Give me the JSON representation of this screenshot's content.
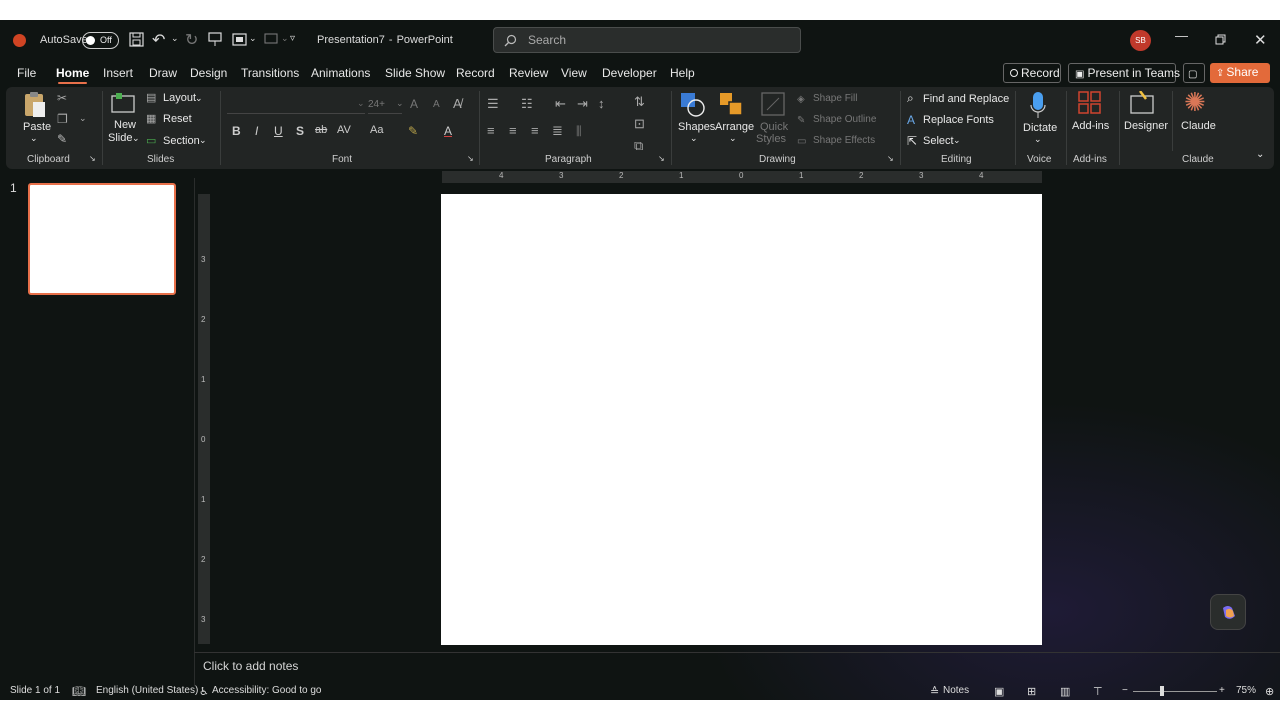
{
  "titlebar": {
    "autosave_label": "AutoSave",
    "autosave_state": "Off",
    "doc_title": "Presentation7",
    "separator": "-",
    "app_name": "PowerPoint",
    "search_placeholder": "Search",
    "avatar_initials": "SB"
  },
  "menu": {
    "tabs": [
      "File",
      "Home",
      "Insert",
      "Draw",
      "Design",
      "Transitions",
      "Animations",
      "Slide Show",
      "Record",
      "Review",
      "View",
      "Developer",
      "Help"
    ],
    "record_button": "Record",
    "present_teams": "Present in Teams",
    "share": "Share"
  },
  "ribbon": {
    "clipboard": {
      "paste": "Paste",
      "group": "Clipboard"
    },
    "slides": {
      "new_slide_1": "New",
      "new_slide_2": "Slide",
      "layout": "Layout",
      "reset": "Reset",
      "section": "Section",
      "group": "Slides"
    },
    "font": {
      "font_size": "24+",
      "group": "Font",
      "bold": "B",
      "italic": "I",
      "underline": "U",
      "shadow": "S",
      "strike": "ab",
      "spacing": "AV",
      "case": "Aa",
      "grow": "A",
      "shrink": "A"
    },
    "paragraph": {
      "group": "Paragraph"
    },
    "drawing": {
      "shapes": "Shapes",
      "arrange": "Arrange",
      "quick_styles_1": "Quick",
      "quick_styles_2": "Styles",
      "shape_fill": "Shape Fill",
      "shape_outline": "Shape Outline",
      "shape_effects": "Shape Effects",
      "group": "Drawing"
    },
    "editing": {
      "find_replace": "Find and Replace",
      "replace_fonts": "Replace Fonts",
      "select": "Select",
      "group": "Editing"
    },
    "voice": {
      "dictate": "Dictate",
      "group": "Voice"
    },
    "addins": {
      "addins": "Add-ins",
      "group": "Add-ins"
    },
    "designer": {
      "designer": "Designer"
    },
    "claude": {
      "claude": "Claude",
      "group": "Claude"
    }
  },
  "panel": {
    "slide_number": "1"
  },
  "ruler": {
    "h_ticks": [
      "4",
      "3",
      "2",
      "1",
      "0",
      "1",
      "2",
      "3",
      "4"
    ],
    "v_ticks": [
      "3",
      "2",
      "1",
      "0",
      "1",
      "2",
      "3"
    ]
  },
  "notes": {
    "placeholder": "Click to add notes"
  },
  "status": {
    "slide_info": "Slide 1 of 1",
    "language": "English (United States)",
    "accessibility": "Accessibility: Good to go",
    "notes_btn": "Notes",
    "zoom": "75%"
  },
  "colors": {
    "accent": "#e8704a",
    "share": "#e36a3a",
    "avatar": "#c0392b",
    "dictate": "#4a9ff0"
  }
}
